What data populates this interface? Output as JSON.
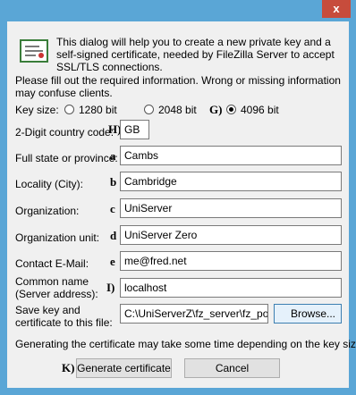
{
  "window": {
    "close_glyph": "x"
  },
  "intro_text": "This dialog will help you to create a new private key and a self-signed certificate, needed by FileZilla Server to accept SSL/TLS connections.",
  "note_text": "Please fill out the required information. Wrong or missing information may confuse clients.",
  "key_size": {
    "label": "Key size:",
    "options": [
      {
        "label": "1280 bit",
        "selected": false
      },
      {
        "label": "2048 bit",
        "selected": false
      },
      {
        "label": "4096 bit",
        "selected": true
      }
    ]
  },
  "fields": {
    "country": {
      "label": "2-Digit country code:",
      "value": "GB"
    },
    "state": {
      "label": "Full state or province:",
      "value": "Cambs"
    },
    "locality": {
      "label": "Locality (City):",
      "value": "Cambridge"
    },
    "organization": {
      "label": "Organization:",
      "value": "UniServer"
    },
    "org_unit": {
      "label": "Organization unit:",
      "value": "UniServer Zero"
    },
    "email": {
      "label": "Contact E-Mail:",
      "value": "me@fred.net"
    },
    "common_name": {
      "label_line1": "Common name",
      "label_line2": "(Server address):",
      "value": "localhost"
    },
    "save_path": {
      "label_line1": "Save key and",
      "label_line2": "certificate to this file:",
      "value": "C:\\UniServerZ\\fz_server\\fz_portable"
    }
  },
  "markers": {
    "g": "G)",
    "h": "H)",
    "a": "a",
    "b": "b",
    "c": "c",
    "d": "d",
    "e": "e",
    "i": "I)",
    "j": "J)",
    "k": "K)"
  },
  "buttons": {
    "browse": "Browse...",
    "generate": "Generate certificate",
    "cancel": "Cancel"
  },
  "footer_text": "Generating the certificate may take some time depending on the key size."
}
